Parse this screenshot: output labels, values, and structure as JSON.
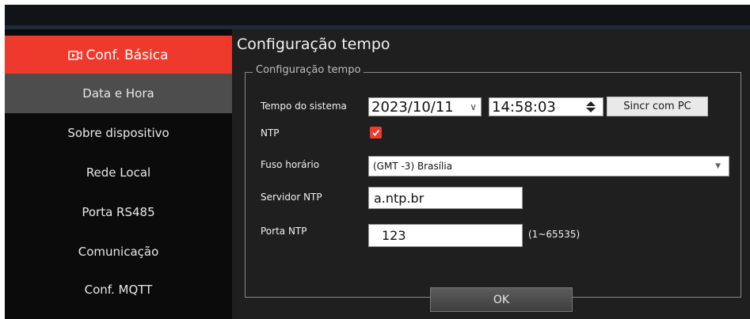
{
  "sidebar": {
    "items": [
      {
        "label": "Conf. Básica",
        "icon": "video-camera-icon",
        "state": "active"
      },
      {
        "label": "Data e Hora",
        "state": "selected"
      },
      {
        "label": "Sobre dispositivo"
      },
      {
        "label": "Rede Local"
      },
      {
        "label": "Porta RS485"
      },
      {
        "label": "Comunicação"
      },
      {
        "label": "Conf. MQTT"
      }
    ]
  },
  "main": {
    "title": "Configuração tempo",
    "group_title": "Configuração tempo",
    "system_time": {
      "label": "Tempo do sistema",
      "date": "2023/10/11",
      "time": "14:58:03",
      "sync_button": "Sincr com PC"
    },
    "ntp": {
      "label": "NTP",
      "checked": true
    },
    "timezone": {
      "label": "Fuso horário",
      "value": "(GMT -3) Brasília"
    },
    "ntp_server": {
      "label": "Servidor NTP",
      "value": "a.ntp.br"
    },
    "ntp_port": {
      "label": "Porta NTP",
      "value": "123",
      "range": "(1~65535)"
    },
    "ok_button": "OK"
  },
  "colors": {
    "accent": "#ee3a2c",
    "sidebar_bg": "#0b0b0b",
    "panel_bg": "#1f1f1f",
    "selected_bg": "#4d4d4d"
  }
}
